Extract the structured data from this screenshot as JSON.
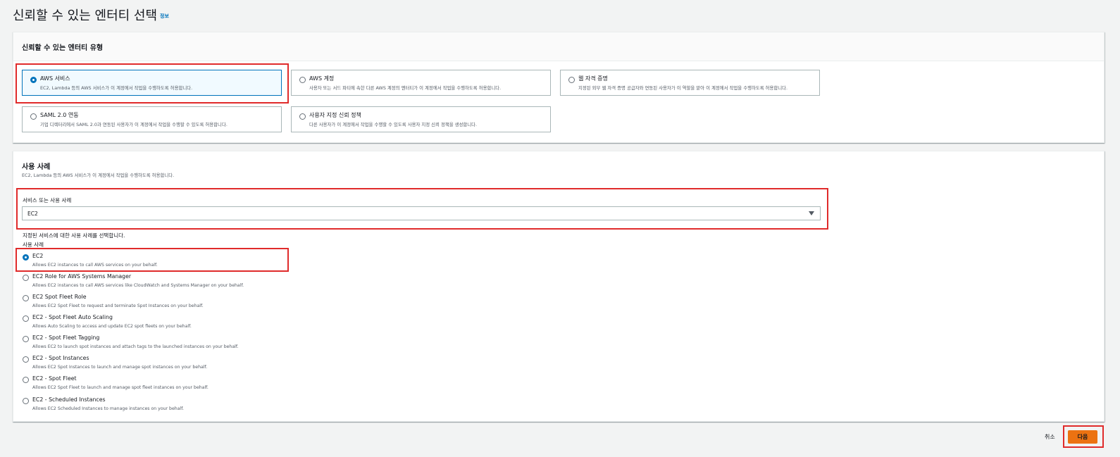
{
  "page": {
    "title": "신뢰할 수 있는 엔터티 선택",
    "info_link": "정보"
  },
  "entity_type": {
    "title": "신뢰할 수 있는 엔터티 유형",
    "options": [
      {
        "label": "AWS 서비스",
        "description": "EC2, Lambda 등의 AWS 서비스가 이 계정에서 작업을 수행하도록 허용합니다.",
        "selected": true
      },
      {
        "label": "AWS 계정",
        "description": "사용자 또는 서드 파티에 속한 다른 AWS 계정의 엔터티가 이 계정에서 작업을 수행하도록 허용합니다.",
        "selected": false
      },
      {
        "label": "웹 자격 증명",
        "description": "지정된 외부 웹 자격 증명 공급자와 연동된 사용자가 이 역할을 맡아 이 계정에서 작업을 수행하도록 허용합니다.",
        "selected": false
      },
      {
        "label": "SAML 2.0 연동",
        "description": "기업 디렉터리에서 SAML 2.0과 연동된 사용자가 이 계정에서 작업을 수행할 수 있도록 허용합니다.",
        "selected": false
      },
      {
        "label": "사용자 지정 신뢰 정책",
        "description": "다른 사용자가 이 계정에서 작업을 수행할 수 있도록 사용자 지정 신뢰 정책을 생성합니다.",
        "selected": false
      }
    ]
  },
  "use_case": {
    "title": "사용 사례",
    "description": "EC2, Lambda 등의 AWS 서비스가 이 계정에서 작업을 수행하도록 허용합니다.",
    "service_label": "서비스 또는 사용 사례",
    "service_value": "EC2",
    "help_text": "지정된 서비스에 대한 사용 사례를 선택합니다.",
    "list_label": "사용 사례",
    "options": [
      {
        "label": "EC2",
        "description": "Allows EC2 instances to call AWS services on your behalf.",
        "selected": true
      },
      {
        "label": "EC2 Role for AWS Systems Manager",
        "description": "Allows EC2 instances to call AWS services like CloudWatch and Systems Manager on your behalf.",
        "selected": false
      },
      {
        "label": "EC2 Spot Fleet Role",
        "description": "Allows EC2 Spot Fleet to request and terminate Spot Instances on your behalf.",
        "selected": false
      },
      {
        "label": "EC2 - Spot Fleet Auto Scaling",
        "description": "Allows Auto Scaling to access and update EC2 spot fleets on your behalf.",
        "selected": false
      },
      {
        "label": "EC2 - Spot Fleet Tagging",
        "description": "Allows EC2 to launch spot instances and attach tags to the launched instances on your behalf.",
        "selected": false
      },
      {
        "label": "EC2 - Spot Instances",
        "description": "Allows EC2 Spot Instances to launch and manage spot instances on your behalf.",
        "selected": false
      },
      {
        "label": "EC2 - Spot Fleet",
        "description": "Allows EC2 Spot Fleet to launch and manage spot fleet instances on your behalf.",
        "selected": false
      },
      {
        "label": "EC2 - Scheduled Instances",
        "description": "Allows EC2 Scheduled Instances to manage instances on your behalf.",
        "selected": false
      }
    ]
  },
  "footer": {
    "cancel_label": "취소",
    "next_label": "다음"
  },
  "colors": {
    "accent": "#0073bb",
    "primary_button": "#ec7211",
    "highlight": "#e02b2b"
  }
}
